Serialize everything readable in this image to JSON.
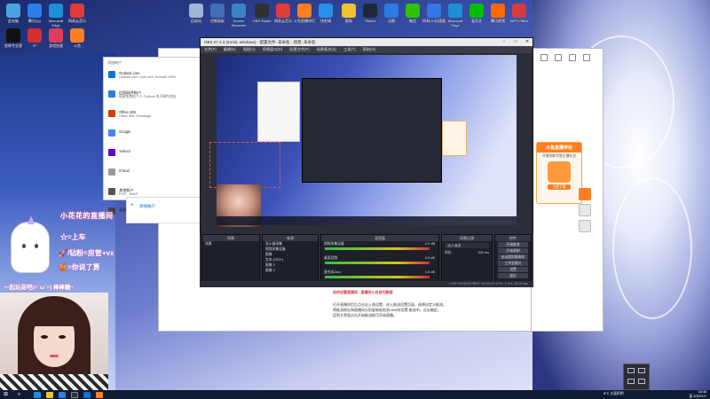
{
  "desktop_icons": [
    {
      "label": "此电脑",
      "color": "#4aa3df"
    },
    {
      "label": "腾讯QQ",
      "color": "#2b7de9"
    },
    {
      "label": "Microsoft Edge",
      "color": "#1c8fd6"
    },
    {
      "label": "网易云音乐",
      "color": "#e03b3b"
    },
    {
      "label": "回收站",
      "color": "#9fb4d8"
    },
    {
      "label": "控制面板",
      "color": "#3f6fb5"
    },
    {
      "label": "Screen Recorder",
      "color": "#3b82c4"
    },
    {
      "label": "OBS Studio",
      "color": "#303030"
    },
    {
      "label": "网易云音乐",
      "color": "#e03b3b"
    },
    {
      "label": "斗鱼直播伴侣",
      "color": "#ff7e1f"
    },
    {
      "label": "快剪辑",
      "color": "#2a8fe8"
    },
    {
      "label": "酷狗",
      "color": "#f2c12e"
    },
    {
      "label": "Steam",
      "color": "#1b2838"
    },
    {
      "label": "迅雷",
      "color": "#2a7be4"
    },
    {
      "label": "微信",
      "color": "#2dc100"
    },
    {
      "label": "网易UU加速器",
      "color": "#3578e5"
    },
    {
      "label": "Microsoft Edge",
      "color": "#1c8fd6"
    },
    {
      "label": "爱奇艺",
      "color": "#00be06"
    },
    {
      "label": "腾讯视频",
      "color": "#ff6a00"
    },
    {
      "label": "WPS Office",
      "color": "#d73b3b"
    },
    {
      "label": "剪映专业版",
      "color": "#111111"
    },
    {
      "label": "97",
      "color": "#d62f2f"
    },
    {
      "label": "游戏加速",
      "color": "#e23b5a"
    },
    {
      "label": "斗鱼",
      "color": "#ff7e1f"
    }
  ],
  "mail_dialog": {
    "title": "添加帐户",
    "items": [
      {
        "title": "Outlook.com",
        "sub": "Outlook.com, Live.com, Hotmail, MSN",
        "color": "#0078d4"
      },
      {
        "title": "旧版邮件帐户",
        "sub": "获取免费的个人 Outlook 电子邮件地址",
        "color": "#2b7cd3"
      },
      {
        "title": "Office 365",
        "sub": "Office 365, Exchange",
        "color": "#d83b01"
      },
      {
        "title": "Google",
        "sub": "",
        "color": "#4285f4"
      },
      {
        "title": "Yahoo!",
        "sub": "",
        "color": "#6001d2"
      },
      {
        "title": "iCloud",
        "sub": "",
        "color": "#999999"
      },
      {
        "title": "其他帐户",
        "sub": "POP、IMAP",
        "color": "#555555"
      },
      {
        "title": "高级设置",
        "sub": "",
        "color": "#444444"
      }
    ],
    "add_label": "添加帐户"
  },
  "obs": {
    "title": "OBS 27.1.3 (64-bit, windows) - 配置文件: 未命名 - 场景: 未命名",
    "menu": [
      "文件(F)",
      "编辑(E)",
      "视图(V)",
      "停靠窗口(D)",
      "配置文件(P)",
      "场景集合(S)",
      "工具(T)",
      "帮助(H)"
    ],
    "docks": {
      "scenes": {
        "title": "场景",
        "items": [
          "场景"
        ]
      },
      "sources": {
        "title": "来源",
        "items": [
          "显示器采集",
          "视频采集设备",
          "图像",
          "文本 (GDI+)",
          "图像 2",
          "图像 3"
        ]
      },
      "mixer": {
        "title": "混音器",
        "tracks": [
          {
            "name": "视频采集设备",
            "db": "0.0 dB"
          },
          {
            "name": "桌面音频",
            "db": "0.0 dB"
          },
          {
            "name": "麦克风/Aux",
            "db": "0.0 dB"
          }
        ]
      },
      "transitions": {
        "title": "场景过渡",
        "type": "淡入淡出",
        "duration_label": "时长",
        "duration": "300 ms"
      },
      "controls": {
        "title": "控件",
        "buttons": [
          "开始推流",
          "开始录制",
          "启动虚拟摄像机",
          "工作室模式",
          "设置",
          "退出"
        ]
      }
    },
    "status": "LIVE: 00:00:00   REC: 00:00:00   CPU: 2.6%, 60.00 fps"
  },
  "promo": {
    "title": "斗鱼直播伴侣",
    "subtitle": "开播领取专属主播礼包",
    "button": "立即下载"
  },
  "browser_text": {
    "headline": "如何设置直播间 · 直播间小白技巧教程",
    "lines": [
      "打开直播伴侣后点击右上角设置，进入推流设置页面，选择自定义推流，",
      "将推流地址和直播码分别复制粘贴到OBS的设置-推流中，点击确定。",
      "回到主界面点击开始推流即可开始直播。"
    ]
  },
  "overlay": {
    "title": "小花花的直播间",
    "lines": [
      "☆=上车",
      "🚀/钻粉=房管+vx",
      "🍯=你说了算"
    ],
    "banner": "一起玩耍吧(=´ω`=)  棒棒糖~"
  },
  "taskbar": {
    "tray_text": "8°C 大面积阴",
    "time": "18:46",
    "date": "2022/1/7",
    "lang": "英"
  }
}
